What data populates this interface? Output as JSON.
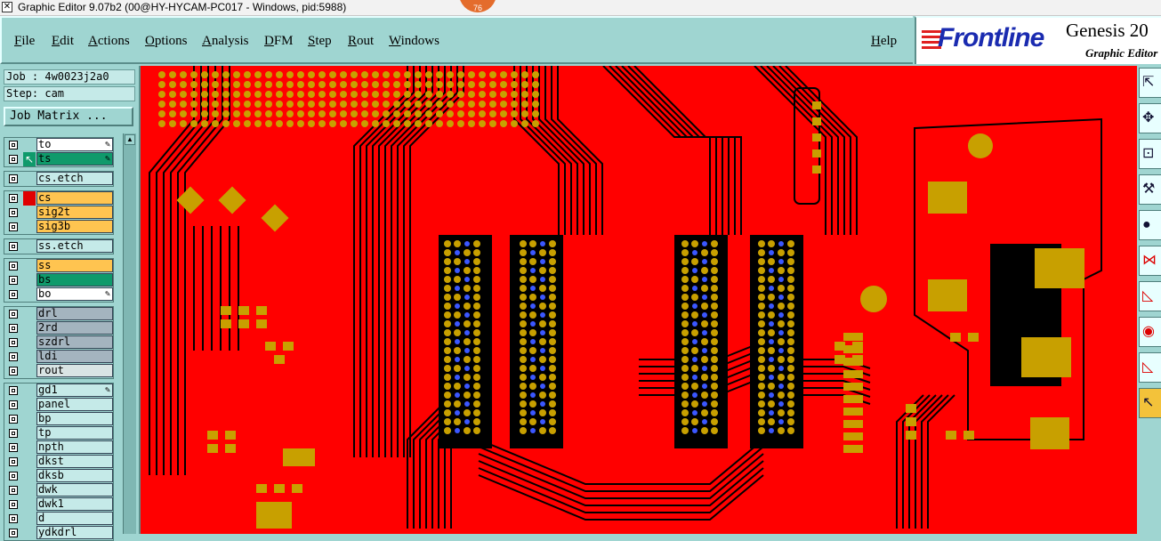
{
  "window": {
    "title": "Graphic Editor 9.07b2 (00@HY-HYCAM-PC017 - Windows, pid:5988)",
    "badge": "76"
  },
  "menu": {
    "file": "File",
    "edit": "Edit",
    "actions": "Actions",
    "options": "Options",
    "analysis": "Analysis",
    "dfm": "DFM",
    "step": "Step",
    "rout": "Rout",
    "windows": "Windows",
    "help": "Help"
  },
  "brand": {
    "logo": "Frontline",
    "product": "Genesis 20",
    "subtitle": "Graphic Editor"
  },
  "job": {
    "job_line": "Job : 4w0023j2a0",
    "step_line": "Step: cam",
    "matrix_button": "Job Matrix ..."
  },
  "layers": [
    {
      "name": "to",
      "color": "#ffffff",
      "indicator": "none",
      "icon": "pencil-icon"
    },
    {
      "name": "ts",
      "color": "#0f9a6b",
      "indicator": "cursor",
      "icon": "pencil-icon"
    },
    {
      "name": "cs.etch",
      "color": "#c5eae8",
      "indicator": "none",
      "icon": ""
    },
    {
      "name": "cs",
      "color": "#ffc450",
      "indicator": "red",
      "icon": ""
    },
    {
      "name": "sig2t",
      "color": "#ffc450",
      "indicator": "none",
      "icon": ""
    },
    {
      "name": "sig3b",
      "color": "#ffc450",
      "indicator": "none",
      "icon": ""
    },
    {
      "name": "ss.etch",
      "color": "#c5eae8",
      "indicator": "none",
      "icon": ""
    },
    {
      "name": "ss",
      "color": "#ffc450",
      "indicator": "none",
      "icon": ""
    },
    {
      "name": "bs",
      "color": "#0f9a6b",
      "indicator": "none",
      "icon": ""
    },
    {
      "name": "bo",
      "color": "#ffffff",
      "indicator": "none",
      "icon": "pencil-icon"
    },
    {
      "name": "drl",
      "color": "#a4b4bf",
      "indicator": "none",
      "icon": ""
    },
    {
      "name": "2rd",
      "color": "#a4b4bf",
      "indicator": "none",
      "icon": ""
    },
    {
      "name": "szdrl",
      "color": "#a4b4bf",
      "indicator": "none",
      "icon": ""
    },
    {
      "name": "ldi",
      "color": "#a4b4bf",
      "indicator": "none",
      "icon": ""
    },
    {
      "name": "rout",
      "color": "#d9e4e4",
      "indicator": "none",
      "icon": ""
    },
    {
      "name": "gd1",
      "color": "#c5eae8",
      "indicator": "none",
      "icon": "pencil-icon"
    },
    {
      "name": "panel",
      "color": "#c5eae8",
      "indicator": "none",
      "icon": ""
    },
    {
      "name": "bp",
      "color": "#c5eae8",
      "indicator": "none",
      "icon": ""
    },
    {
      "name": "tp",
      "color": "#c5eae8",
      "indicator": "none",
      "icon": ""
    },
    {
      "name": "npth",
      "color": "#c5eae8",
      "indicator": "none",
      "icon": ""
    },
    {
      "name": "dkst",
      "color": "#c5eae8",
      "indicator": "none",
      "icon": ""
    },
    {
      "name": "dksb",
      "color": "#c5eae8",
      "indicator": "none",
      "icon": ""
    },
    {
      "name": "dwk",
      "color": "#c5eae8",
      "indicator": "none",
      "icon": ""
    },
    {
      "name": "dwk1",
      "color": "#c5eae8",
      "indicator": "none",
      "icon": ""
    },
    {
      "name": "d",
      "color": "#c5eae8",
      "indicator": "none",
      "icon": ""
    },
    {
      "name": "ydkdrl",
      "color": "#c5eae8",
      "indicator": "none",
      "icon": ""
    }
  ],
  "canvas": {
    "board_color": "#ff0000",
    "trace_color": "#000000",
    "pad_color": "#c8a000",
    "via_color": "#3b57ff"
  },
  "tools": [
    "move-tool-icon",
    "pan-tool-icon",
    "zoom-box-icon",
    "snap-tool-icon",
    "fill-circle-icon",
    "net-tool-icon",
    "measure-icon",
    "probe-icon",
    "ruler-icon",
    "select-arrow-icon"
  ]
}
